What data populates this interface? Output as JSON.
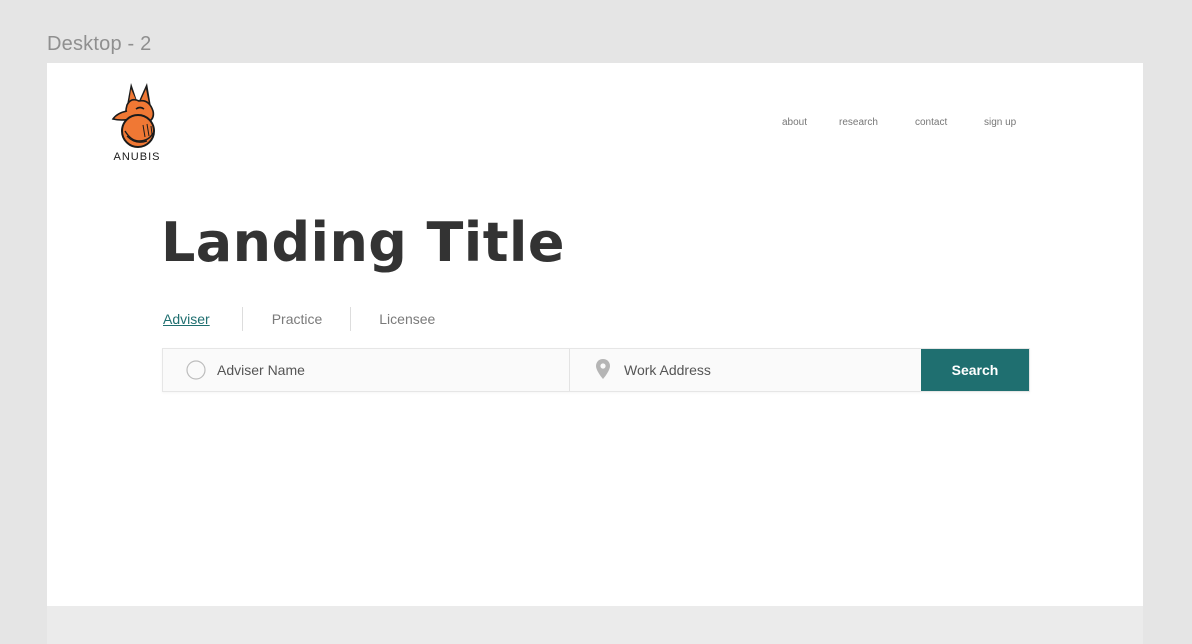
{
  "canvas": {
    "frame_label": "Desktop - 2"
  },
  "brand": {
    "name": "ANUBIS",
    "logo_icon": "anubis-fox-icon",
    "accent_color": "#f07834"
  },
  "nav": {
    "about": "about",
    "research": "research",
    "contact": "contact",
    "sign_up": "sign up"
  },
  "hero": {
    "title": "Landing Title"
  },
  "tabs": {
    "items": [
      {
        "label": "Adviser",
        "active": true
      },
      {
        "label": "Practice",
        "active": false
      },
      {
        "label": "Licensee",
        "active": false
      }
    ]
  },
  "search": {
    "name_placeholder": "Adviser Name",
    "name_icon": "search-icon",
    "address_placeholder": "Work Address",
    "address_icon": "location-pin-icon",
    "button_label": "Search",
    "button_color": "#1f6f70"
  }
}
